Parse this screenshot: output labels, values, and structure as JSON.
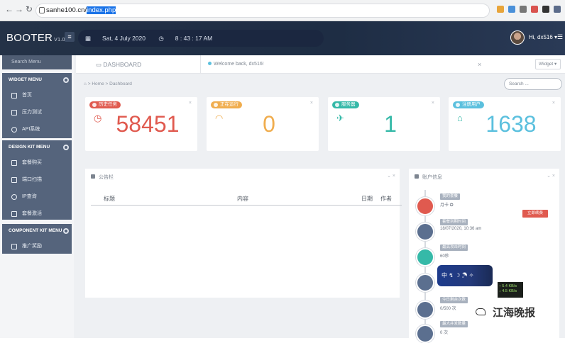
{
  "browser": {
    "url_host": "sanhe100.cn/",
    "url_selected": "index.php"
  },
  "header": {
    "brand": "BOOTER",
    "version": "V1.0",
    "date": "Sat, 4 July 2020",
    "time": "8 : 43 : 17 AM",
    "user_greeting": "Hi, dx516 ▾",
    "more": "☰"
  },
  "sidebar": {
    "search_placeholder": "Search Menu",
    "widget_menu": {
      "title": "WIDGET MENU",
      "items": [
        "首页",
        "压力测试",
        "API系统"
      ]
    },
    "design_kit_menu": {
      "title": "DESIGN KIT MENU",
      "items": [
        "套餐购买",
        "端口扫描",
        "IP查询",
        "套餐激活"
      ]
    },
    "component_kit_menu": {
      "title": "COMPONENT KIT MENU",
      "items": [
        "推广奖励"
      ]
    }
  },
  "topbar": {
    "dashboard_tab": "DASHBOARD",
    "welcome": "Welcome back, dx516!",
    "close": "×",
    "widget_button": "Widget ▾"
  },
  "breadcrumb": {
    "home": "Home",
    "separator": ">",
    "current": "Dashboard"
  },
  "search": {
    "placeholder": "Search ..."
  },
  "stats": [
    {
      "label": "历史任务",
      "value": "58451",
      "color": "#e05a4f"
    },
    {
      "label": "正在运行",
      "value": "0",
      "color": "#f0ad4e"
    },
    {
      "label": "服务器",
      "value": "1",
      "color": "#35b9a8"
    },
    {
      "label": "注册用户",
      "value": "1638",
      "color": "#5bc0de"
    }
  ],
  "notice_panel": {
    "title": "公告栏",
    "columns": [
      "标题",
      "内容",
      "日期",
      "作者"
    ]
  },
  "account_panel": {
    "title": "账户信息",
    "items": [
      {
        "tag": "我的套餐",
        "text": "月卡 ✪"
      },
      {
        "tag": "套餐到期时间",
        "text": "18/07/2020, 10:36 am"
      },
      {
        "tag": "最高攻击时间",
        "text": "60秒"
      },
      {
        "tag": "",
        "text": ""
      },
      {
        "tag": "今日剩余次数",
        "text": "0/500 次"
      },
      {
        "tag": "最大并发数量",
        "text": "0 次"
      }
    ],
    "renew_button": "立即续费",
    "image_card_text": "中 ↯ ☽ ☂ ✧",
    "speed_up": "↑ 5.4 KB/s",
    "speed_down": "↓ 4.5 KB/s"
  },
  "watermark": "江海晚报",
  "colors": {
    "header_bg": "#243247",
    "sidebar_section": "#55647c",
    "danger": "#e05a4f",
    "warning": "#f0ad4e",
    "teal": "#35b9a8",
    "info": "#5bc0de"
  }
}
